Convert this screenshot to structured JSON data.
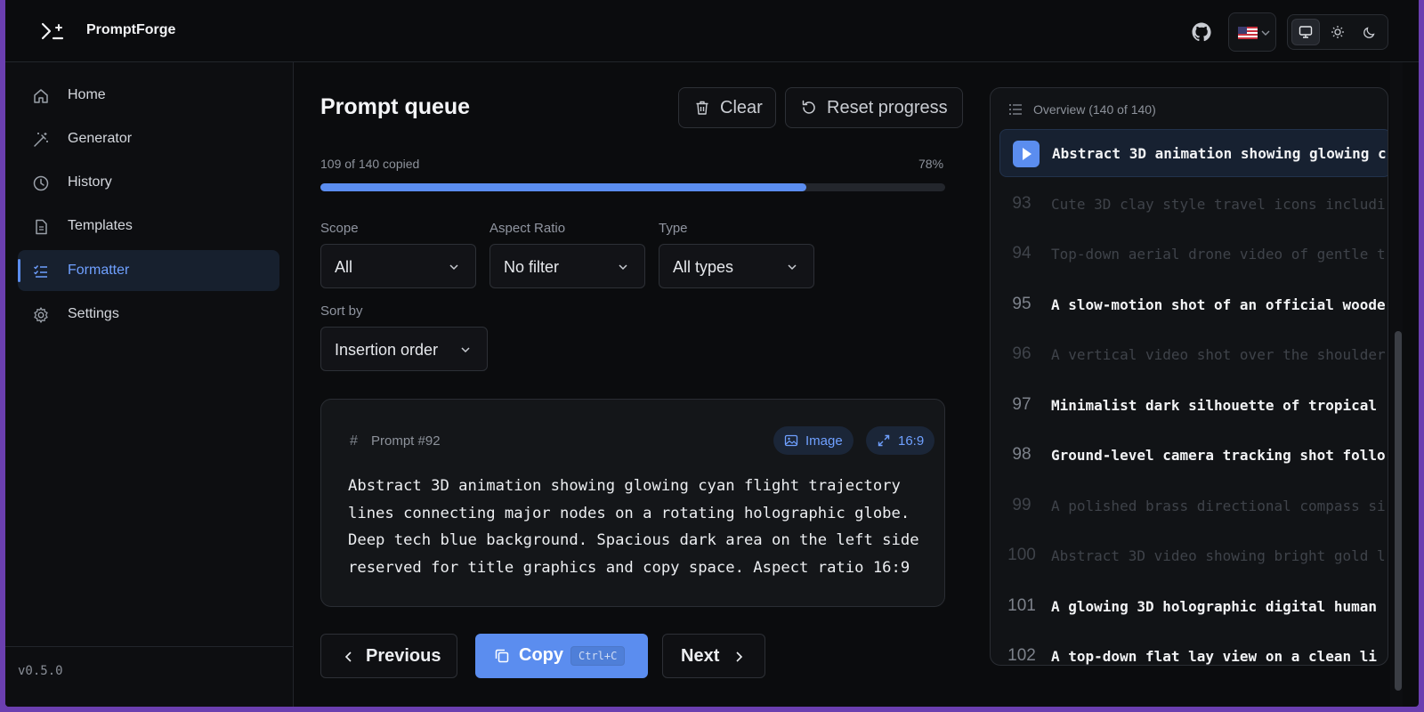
{
  "app": {
    "name": "PromptForge",
    "version": "v0.5.0"
  },
  "header": {
    "github_icon": "github-icon",
    "language": {
      "flag": "us-flag-icon"
    },
    "theme": {
      "options": [
        "desktop",
        "light",
        "dark"
      ],
      "active": "desktop"
    }
  },
  "sidebar": {
    "items": [
      {
        "label": "Home",
        "icon": "home-icon"
      },
      {
        "label": "Generator",
        "icon": "magic-wand-icon"
      },
      {
        "label": "History",
        "icon": "clock-icon"
      },
      {
        "label": "Templates",
        "icon": "document-icon"
      },
      {
        "label": "Formatter",
        "icon": "list-check-icon",
        "active": true
      },
      {
        "label": "Settings",
        "icon": "gear-icon"
      }
    ]
  },
  "main": {
    "title": "Prompt queue",
    "clear_label": "Clear",
    "reset_label": "Reset progress",
    "progress": {
      "label": "109 of 140 copied",
      "percent_label": "78%",
      "fraction": 0.778
    },
    "filters": {
      "scope": {
        "label": "Scope",
        "value": "All"
      },
      "aspect": {
        "label": "Aspect Ratio",
        "value": "No filter"
      },
      "type": {
        "label": "Type",
        "value": "All types"
      },
      "sort": {
        "label": "Sort by",
        "value": "Insertion order"
      }
    },
    "prompt": {
      "hash": "#",
      "id_label": "Prompt #92",
      "type_chip": "Image",
      "ratio_chip": "16:9",
      "text": "Abstract 3D animation showing glowing cyan flight trajectory\nlines connecting major nodes on a rotating holographic globe.\nDeep tech blue background. Spacious dark area on the left side\nreserved for title graphics and copy space. Aspect ratio 16:9"
    },
    "nav": {
      "previous": "Previous",
      "copy": "Copy",
      "copy_shortcut": "Ctrl+C",
      "next": "Next"
    }
  },
  "overview": {
    "title": "Overview (140 of 140)",
    "items": [
      {
        "num": "",
        "text": "Abstract 3D animation showing glowing c",
        "state": "current"
      },
      {
        "num": "93",
        "text": "Cute 3D clay style travel icons includi",
        "state": "dim"
      },
      {
        "num": "94",
        "text": "Top-down aerial drone video of gentle t",
        "state": "dim"
      },
      {
        "num": "95",
        "text": "A slow-motion shot of an official woode",
        "state": "bright"
      },
      {
        "num": "96",
        "text": "A vertical video shot over the shoulder",
        "state": "dim"
      },
      {
        "num": "97",
        "text": "Minimalist dark silhouette of tropical ",
        "state": "bright"
      },
      {
        "num": "98",
        "text": "Ground-level camera tracking shot follo",
        "state": "bright"
      },
      {
        "num": "99",
        "text": "A polished brass directional compass si",
        "state": "dim"
      },
      {
        "num": "100",
        "text": "Abstract 3D video showing bright gold l",
        "state": "dim"
      },
      {
        "num": "101",
        "text": "A glowing 3D holographic digital human ",
        "state": "bright"
      },
      {
        "num": "102",
        "text": "A top-down flat lay view on a clean li",
        "state": "bright"
      }
    ]
  },
  "colors": {
    "accent": "#5b8def",
    "background": "#0b0c0e",
    "frame": "#6b3fb0"
  }
}
